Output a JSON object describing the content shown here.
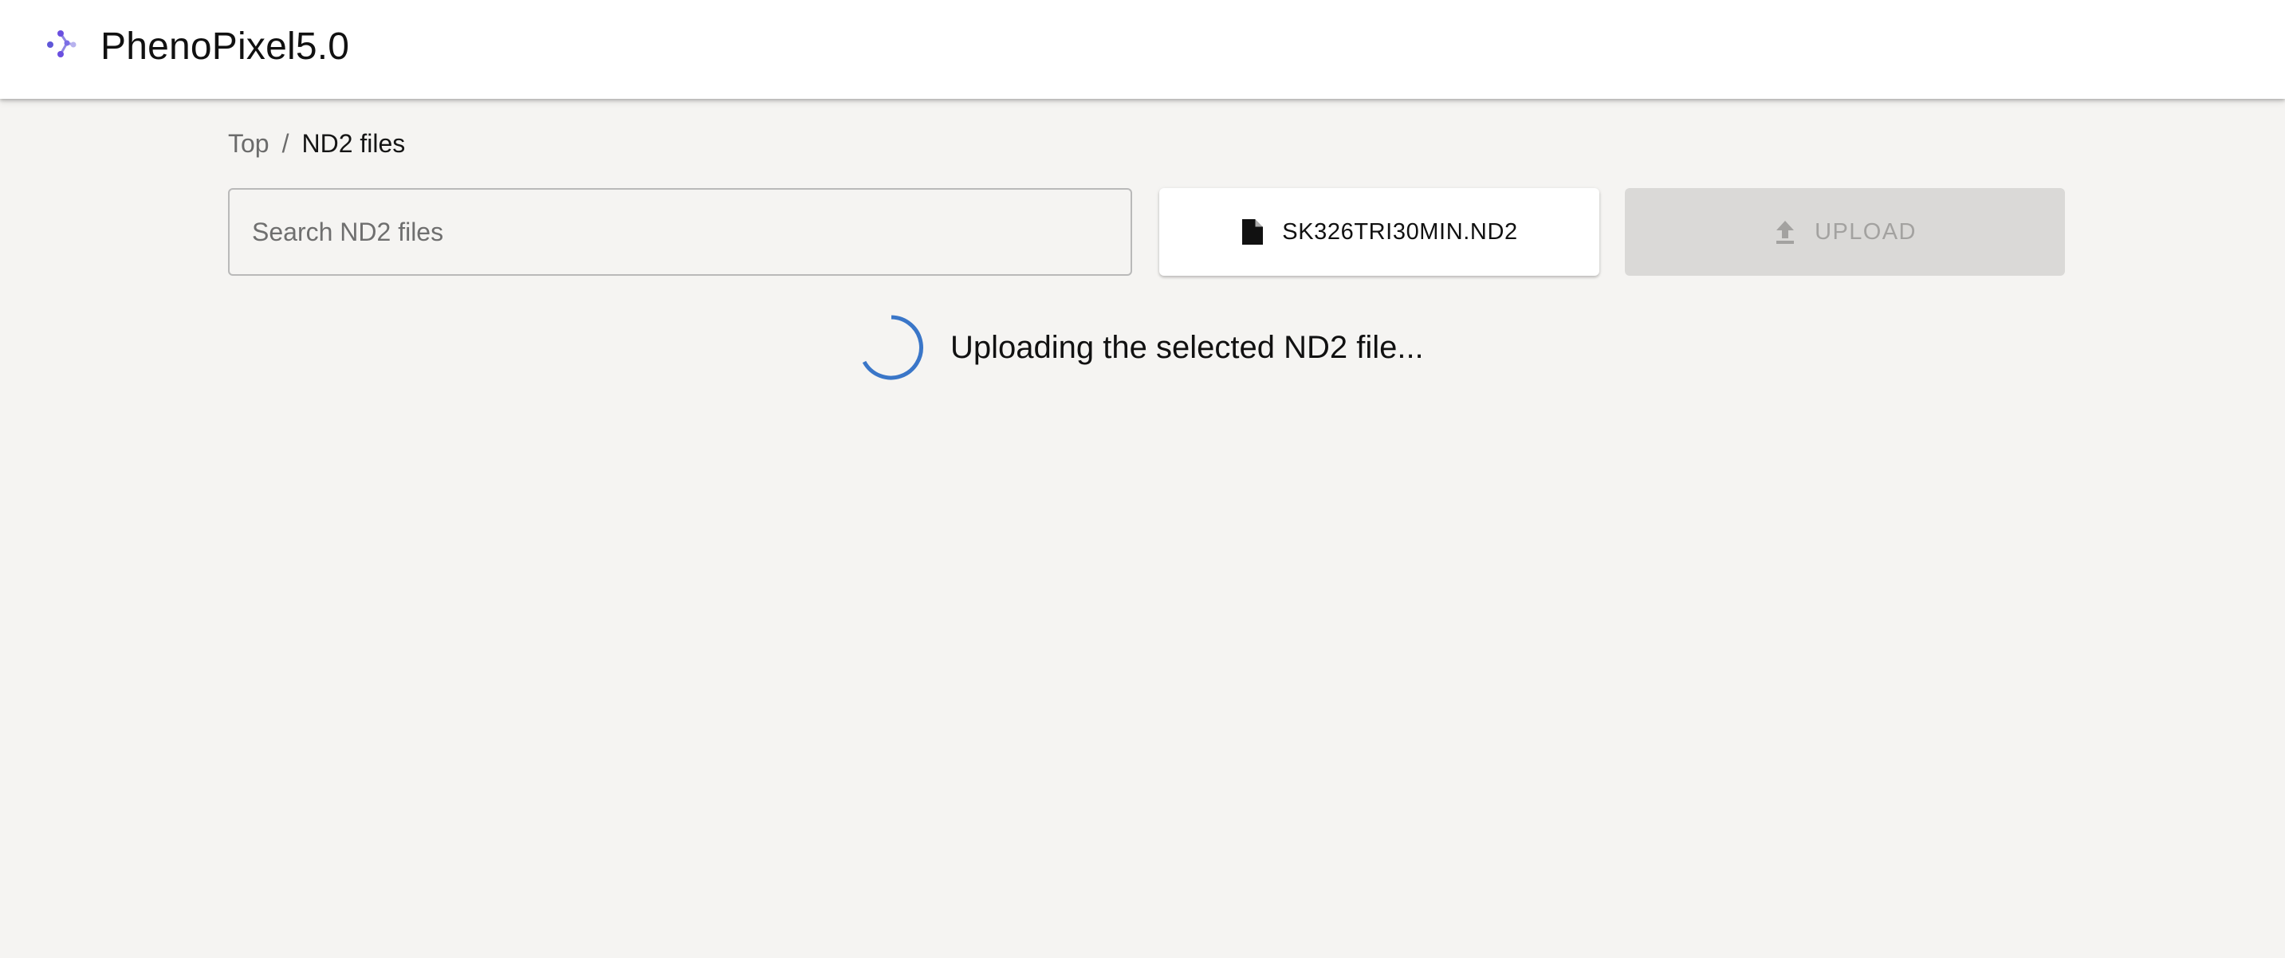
{
  "app": {
    "title": "PhenoPixel5.0",
    "logo_icon": "molecule-logo-icon",
    "accent_color": "#5b3fd6"
  },
  "breadcrumb": {
    "items": [
      {
        "label": "Top",
        "current": false
      },
      {
        "label": "ND2 files",
        "current": true
      }
    ],
    "separator": "/"
  },
  "search": {
    "placeholder": "Search ND2 files",
    "value": ""
  },
  "file_picker": {
    "icon": "file-icon",
    "label": "SK326TRI30MIN.ND2"
  },
  "upload": {
    "icon": "upload-icon",
    "label": "UPLOAD",
    "disabled": true
  },
  "status": {
    "spinner_icon": "loading-spinner-icon",
    "spinner_color": "#3a76c8",
    "message": "Uploading the selected ND2 file..."
  }
}
